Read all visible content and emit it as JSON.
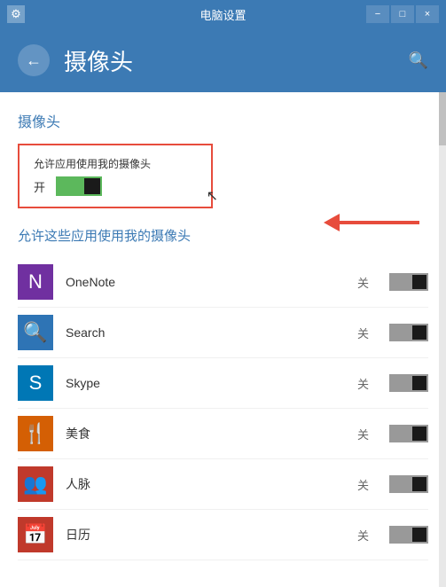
{
  "titleBar": {
    "icon": "⚙",
    "title": "电脑设置",
    "minimizeLabel": "−",
    "restoreLabel": "□",
    "closeLabel": "×"
  },
  "header": {
    "backIcon": "←",
    "title": "摄像头",
    "searchIcon": "🔍"
  },
  "content": {
    "sectionTitle": "摄像头",
    "cameraToggle": {
      "label": "允许应用使用我的摄像头",
      "status": "开"
    },
    "appsSubtitle": "允许这些应用使用我的摄像头",
    "apps": [
      {
        "name": "OneNote",
        "status": "关",
        "iconClass": "icon-onenote",
        "iconText": "N"
      },
      {
        "name": "Search",
        "status": "关",
        "iconClass": "icon-search",
        "iconText": "🔍"
      },
      {
        "name": "Skype",
        "status": "关",
        "iconClass": "icon-skype",
        "iconText": "S"
      },
      {
        "name": "美食",
        "status": "关",
        "iconClass": "icon-food",
        "iconText": "🍴"
      },
      {
        "name": "人脉",
        "status": "关",
        "iconClass": "icon-people",
        "iconText": "👥"
      },
      {
        "name": "日历",
        "status": "关",
        "iconClass": "icon-calendar",
        "iconText": "📅"
      }
    ]
  }
}
